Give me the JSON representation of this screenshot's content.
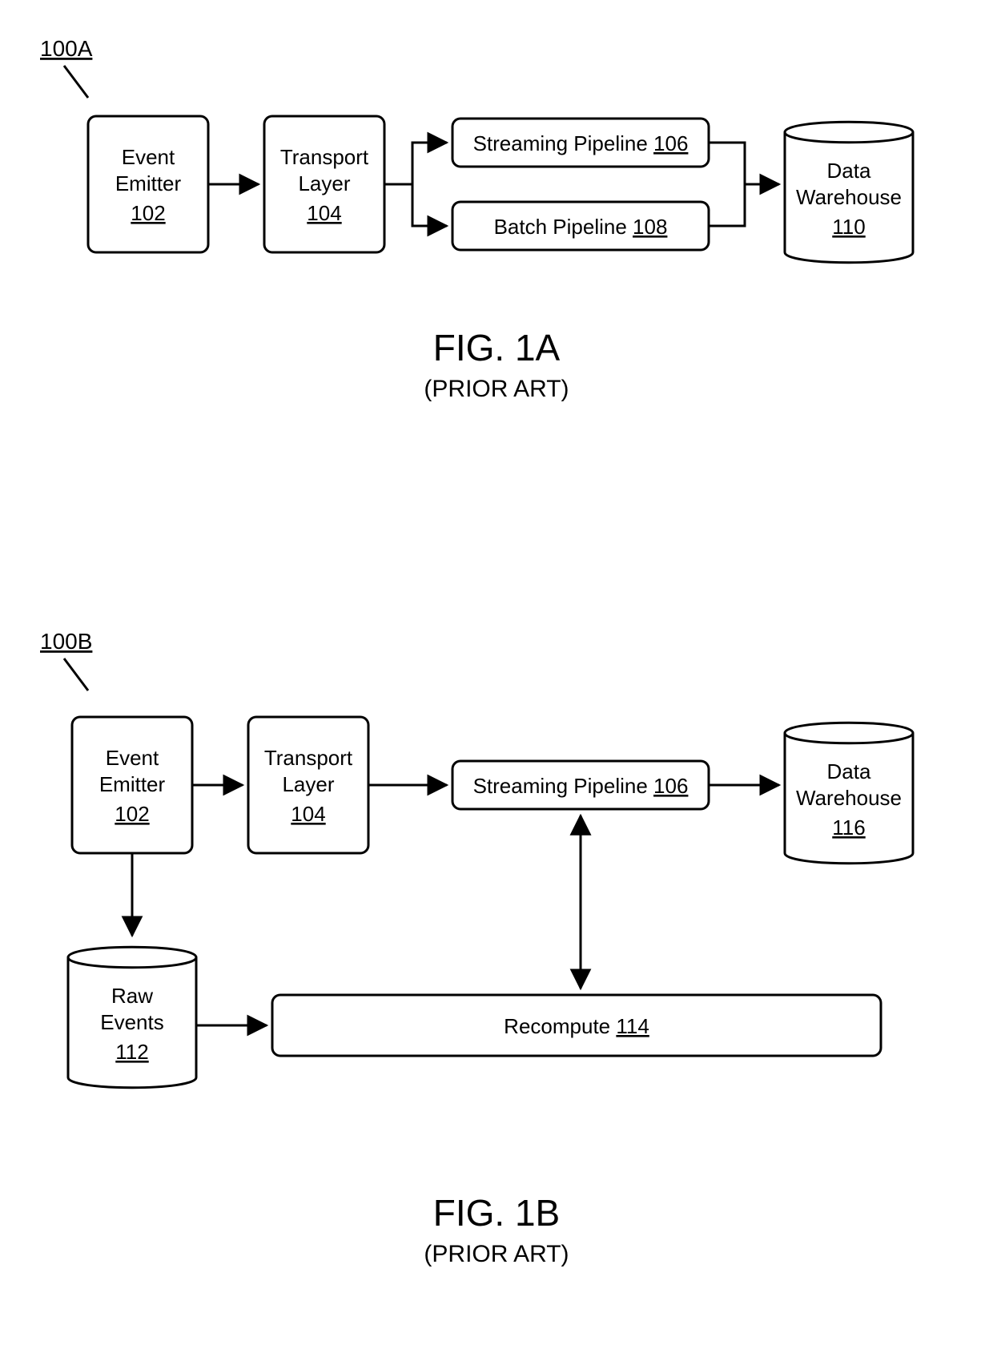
{
  "figA": {
    "num": "100A",
    "title": "FIG. 1A",
    "subtitle": "(PRIOR ART)",
    "eventEmitter": {
      "line1": "Event",
      "line2": "Emitter",
      "ref": "102"
    },
    "transportLayer": {
      "line1": "Transport",
      "line2": "Layer",
      "ref": "104"
    },
    "streaming": {
      "label": "Streaming Pipeline ",
      "ref": "106"
    },
    "batch": {
      "label": "Batch Pipeline ",
      "ref": "108"
    },
    "warehouse": {
      "line1": "Data",
      "line2": "Warehouse",
      "ref": "110"
    }
  },
  "figB": {
    "num": "100B",
    "title": "FIG. 1B",
    "subtitle": "(PRIOR ART)",
    "eventEmitter": {
      "line1": "Event",
      "line2": "Emitter",
      "ref": "102"
    },
    "transportLayer": {
      "line1": "Transport",
      "line2": "Layer",
      "ref": "104"
    },
    "streaming": {
      "label": "Streaming Pipeline ",
      "ref": "106"
    },
    "rawEvents": {
      "line1": "Raw",
      "line2": "Events",
      "ref": "112"
    },
    "recompute": {
      "label": "Recompute ",
      "ref": "114"
    },
    "warehouse": {
      "line1": "Data",
      "line2": "Warehouse",
      "ref": "116"
    }
  }
}
